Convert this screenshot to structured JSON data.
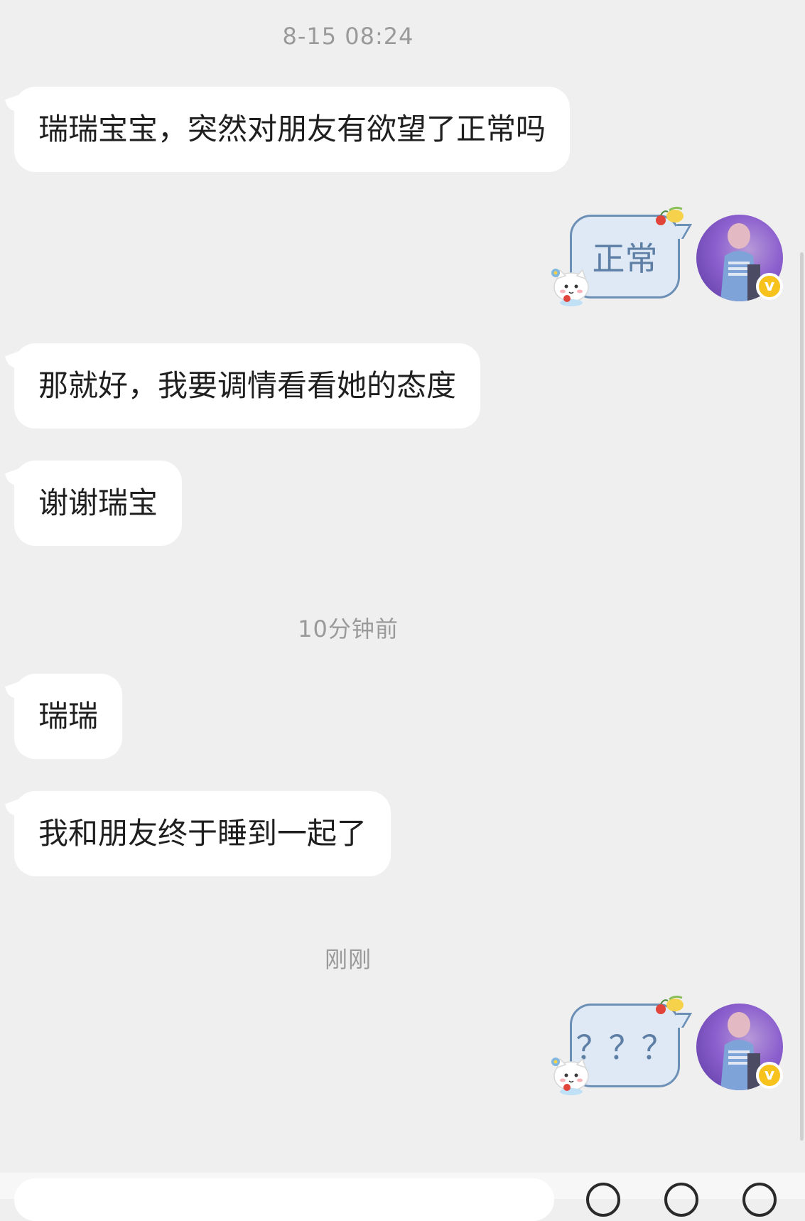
{
  "timestamps": {
    "first": "8-15 08:24",
    "second": "10分钟前",
    "third": "刚刚"
  },
  "messages": {
    "m1": "瑞瑞宝宝，突然对朋友有欲望了正常吗",
    "m2": "正常",
    "m3": "那就好，我要调情看看她的态度",
    "m4": "谢谢瑞宝",
    "m5": "瑞瑞",
    "m6": "我和朋友终于睡到一起了",
    "m7": "？？？"
  },
  "badge": {
    "label": "v",
    "color": "#f6c21b"
  },
  "colors": {
    "background": "#efefef",
    "incoming_bubble": "#ffffff",
    "outgoing_bubble": "#dfe9f5",
    "outgoing_border": "#6c8fb6",
    "outgoing_text": "#5e7fa5"
  },
  "icons": {
    "avatar": "avatar-icon",
    "fruit": "fruit-sticker-icon",
    "cat": "cat-sticker-icon",
    "verified": "verified-badge-icon"
  }
}
